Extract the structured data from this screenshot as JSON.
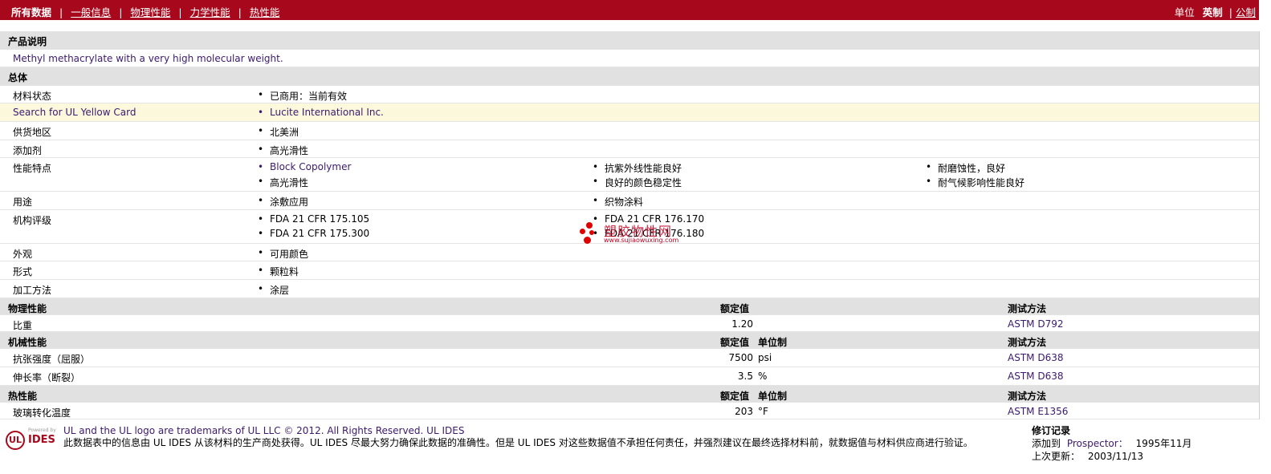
{
  "nav": {
    "current": "所有数据",
    "sep": "|",
    "items": [
      "一般信息",
      "物理性能",
      "力学性能",
      "热性能"
    ],
    "units_label": "单位",
    "unit_english": "英制",
    "unit_metric": "公制"
  },
  "description": {
    "header": "产品说明",
    "text": "Methyl methacrylate with a very high molecular weight."
  },
  "general": {
    "header": "总体",
    "rows": [
      {
        "label": "材料状态",
        "values": [
          "已商用：当前有效"
        ]
      },
      {
        "label": "Search for UL Yellow Card",
        "values": [
          "Lucite International Inc."
        ]
      },
      {
        "label": "供货地区",
        "values": [
          "北美洲"
        ]
      },
      {
        "label": "添加剂",
        "values": [
          "高光滑性"
        ]
      },
      {
        "label": "性能特点",
        "values": [
          "Block Copolymer",
          "抗紫外线性能良好",
          "耐磨蚀性，良好",
          "高光滑性",
          "良好的颜色稳定性",
          "耐气候影响性能良好"
        ]
      },
      {
        "label": "用途",
        "values": [
          "涂敷应用",
          "织物涂料"
        ]
      },
      {
        "label": "机构评级",
        "values": [
          "FDA 21 CFR 175.105",
          "FDA 21 CFR 176.170",
          "FDA 21 CFR 175.300",
          "FDA 21 CFR 176.180"
        ]
      },
      {
        "label": "外观",
        "values": [
          "可用颜色"
        ]
      },
      {
        "label": "形式",
        "values": [
          "颗粒料"
        ]
      },
      {
        "label": "加工方法",
        "values": [
          "涂层"
        ]
      }
    ]
  },
  "physical": {
    "header": "物理性能",
    "col_value": "额定值",
    "col_method": "测试方法",
    "rows": [
      {
        "label": "比重",
        "value": "1.20",
        "unit": "",
        "method": "ASTM D792"
      }
    ]
  },
  "mechanical": {
    "header": "机械性能",
    "col_value": "额定值",
    "col_unit": "单位制",
    "col_method": "测试方法",
    "rows": [
      {
        "label": "抗张强度（屈服）",
        "value": "7500",
        "unit": "psi",
        "method": "ASTM D638"
      },
      {
        "label": "伸长率（断裂）",
        "value": "3.5",
        "unit": "%",
        "method": "ASTM D638"
      }
    ]
  },
  "thermal": {
    "header": "热性能",
    "col_value": "额定值",
    "col_unit": "单位制",
    "col_method": "测试方法",
    "rows": [
      {
        "label": "玻璃转化温度",
        "value": "203",
        "unit": "°F",
        "method": "ASTM E1356"
      }
    ]
  },
  "watermark": {
    "title": "塑胶物性网",
    "url": "www.sujiaowuxing.com"
  },
  "footer": {
    "logo_circle": "UL",
    "logo_powered": "Powered by",
    "logo_ides": "IDES",
    "trademark": "UL and the UL logo are trademarks of UL LLC © 2012. All Rights Reserved. UL IDES",
    "disclaimer": "此数据表中的信息由 UL IDES 从该材料的生产商处获得。UL IDES 尽最大努力确保此数据的准确性。但是 UL IDES 对这些数据值不承担任何责任，并强烈建议在最终选择材料前，就数据值与材料供应商进行验证。",
    "revision_title": "修订记录",
    "added_label": "添加到",
    "added_site": "Prospector：",
    "added_date": "1995年11月",
    "updated_label": "上次更新：",
    "updated_date": "2003/11/13"
  }
}
